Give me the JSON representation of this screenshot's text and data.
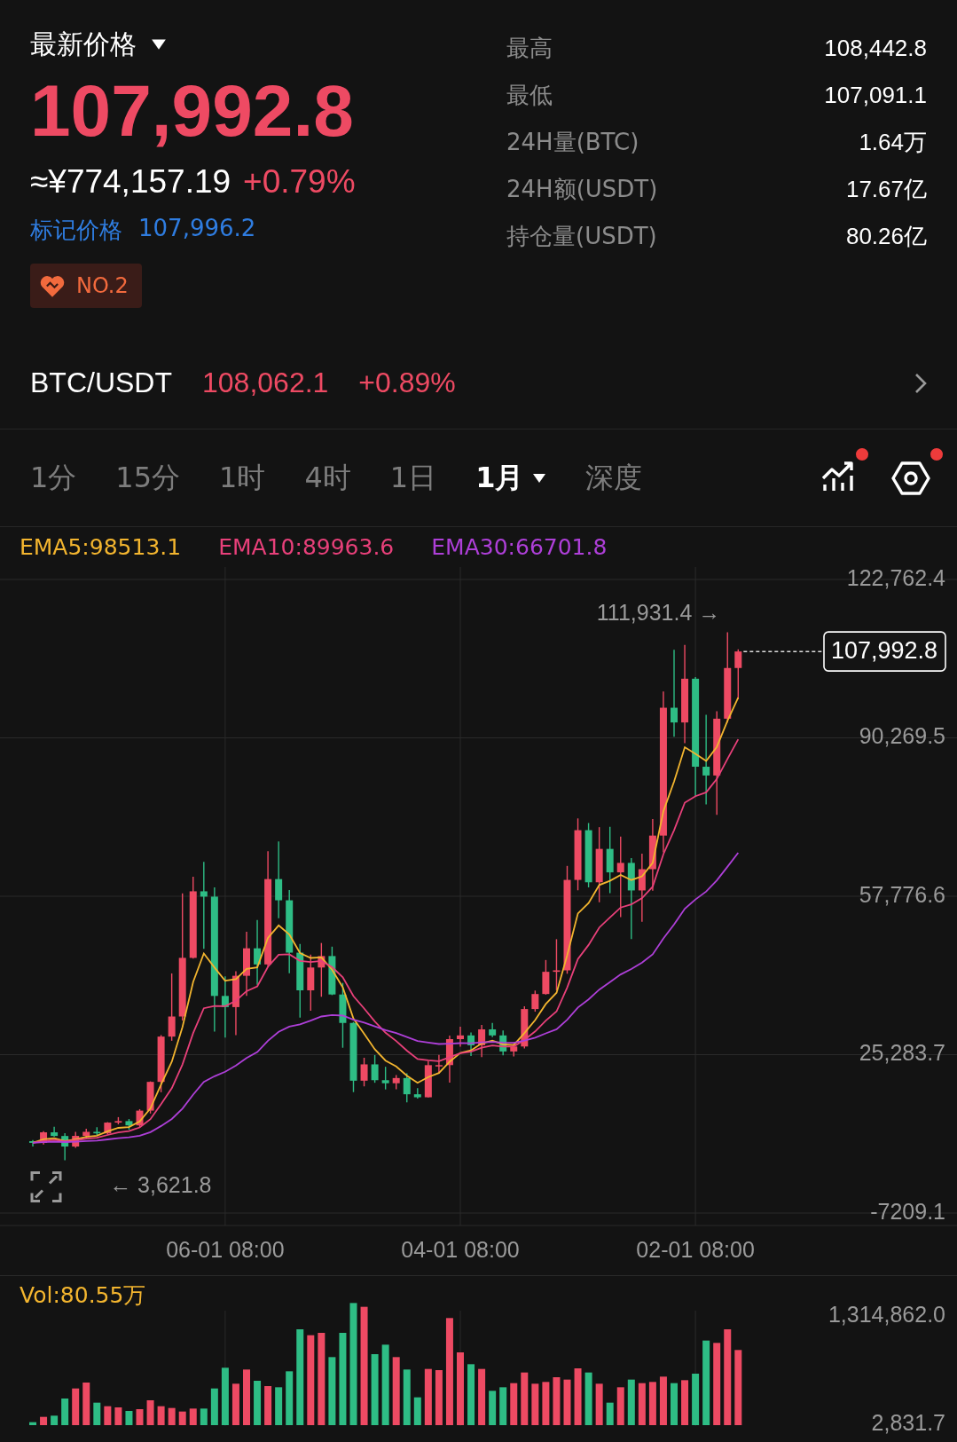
{
  "header": {
    "title": "最新价格",
    "price": "107,992.8",
    "cny": "≈¥774,157.19",
    "change": "+0.79%",
    "mark_label": "标记价格",
    "mark_price": "107,996.2",
    "rank": "NO.2"
  },
  "stats": [
    {
      "label": "最高",
      "value": "108,442.8"
    },
    {
      "label": "最低",
      "value": "107,091.1"
    },
    {
      "label": "24H量(BTC)",
      "value": "1.64万"
    },
    {
      "label": "24H额(USDT)",
      "value": "17.67亿"
    },
    {
      "label": "持仓量(USDT)",
      "value": "80.26亿"
    }
  ],
  "spot": {
    "pair": "BTC/USDT",
    "price": "108,062.1",
    "change": "+0.89%"
  },
  "tabs": [
    {
      "label": "1分",
      "selected": false,
      "menu": false
    },
    {
      "label": "15分",
      "selected": false,
      "menu": false
    },
    {
      "label": "1时",
      "selected": false,
      "menu": false
    },
    {
      "label": "4时",
      "selected": false,
      "menu": false
    },
    {
      "label": "1日",
      "selected": false,
      "menu": false
    },
    {
      "label": "1月",
      "selected": true,
      "menu": true
    },
    {
      "label": "深度",
      "selected": false,
      "menu": false
    }
  ],
  "toolbar": [
    {
      "kind": "indicators",
      "badge": true
    },
    {
      "kind": "settings",
      "badge": true
    }
  ],
  "chart": {
    "chart_data": {
      "type": "candlestick",
      "grid": true,
      "categories": [
        null,
        null,
        null,
        null,
        null,
        null,
        null,
        null,
        null,
        null,
        null,
        null,
        null,
        null,
        null,
        null,
        null,
        null,
        "06-01 08:00",
        null,
        null,
        null,
        null,
        null,
        null,
        null,
        null,
        null,
        null,
        null,
        null,
        null,
        null,
        null,
        null,
        null,
        null,
        null,
        null,
        null,
        "04-01 08:00",
        null,
        null,
        null,
        null,
        null,
        null,
        null,
        null,
        null,
        null,
        null,
        null,
        null,
        null,
        null,
        null,
        null,
        null,
        null,
        null,
        null,
        "02-01 08:00",
        null,
        null,
        null,
        null
      ],
      "series": [
        {
          "name": "EMA5:98513.1",
          "type": "line",
          "color": "#f3b52f",
          "values": [
            7190,
            7910,
            8140,
            7573,
            7922,
            8431,
            8668,
            9562,
            10258,
            10432,
            11553,
            14270,
            19176,
            23821,
            30927,
            40215,
            46043,
            43139,
            40439,
            40779,
            42886,
            43188,
            49225,
            51800,
            49937,
            46118,
            45132,
            45258,
            42715,
            39074,
            32696,
            29560,
            26390,
            24067,
            22875,
            20970,
            19493,
            20705,
            21517,
            23835,
            25633,
            26159,
            27596,
            28141,
            27407,
            27258,
            29719,
            32386,
            35684,
            37983,
            45698,
            54242,
            56375,
            60080,
            60947,
            62171,
            61104,
            61846,
            64637,
            75242,
            81304,
            88336,
            87008,
            85522,
            88414,
            93810,
            98537
          ]
        },
        {
          "name": "EMA10:89963.6",
          "type": "line",
          "color": "#e8407a",
          "values": [
            7190,
            7583,
            7768,
            7526,
            7725,
            8039,
            8239,
            8805,
            9322,
            9587,
            10353,
            12052,
            15132,
            18401,
            23262,
            29722,
            34809,
            35267,
            35226,
            36359,
            38312,
            39308,
            43307,
            45787,
            45864,
            44522,
            44274,
            44499,
            43250,
            41166,
            37307,
            34758,
            32084,
            29782,
            28092,
            26105,
            24366,
            24141,
            23959,
            24779,
            25588,
            25883,
            26717,
            27174,
            26950,
            26952,
            28349,
            30053,
            32276,
            34150,
            39055,
            44923,
            47781,
            51364,
            53422,
            55458,
            56096,
            57412,
            59740,
            66415,
            71327,
            76976,
            78317,
            79087,
            81835,
            85974,
            89977
          ]
        },
        {
          "name": "EMA30:66701.8",
          "type": "line",
          "color": "#ae3fd8",
          "values": [
            7190,
            7329,
            7411,
            7349,
            7431,
            7561,
            7663,
            7901,
            8143,
            8313,
            8667,
            9379,
            10644,
            12093,
            14225,
            17100,
            19720,
            20856,
            21771,
            23041,
            24593,
            25832,
            28120,
            29980,
            31027,
            31508,
            32260,
            33115,
            33406,
            33302,
            32440,
            31849,
            31088,
            30335,
            29700,
            28891,
            28094,
            27774,
            27475,
            27539,
            27648,
            27620,
            27804,
            27896,
            27770,
            27717,
            28164,
            28781,
            29652,
            30486,
            32463,
            34970,
            36626,
            38618,
            40170,
            41747,
            42859,
            44179,
            45859,
            49123,
            51982,
            55235,
            57113,
            58754,
            61041,
            63851,
            66699
          ]
        }
      ],
      "ylim": [
        -7209.1,
        122762.4
      ],
      "yticks": [
        {
          "value": 122762.4,
          "label": "122,762.4"
        },
        {
          "value": 90269.5,
          "label": "90,269.5"
        },
        {
          "value": 57776.6,
          "label": "57,776.6"
        },
        {
          "value": 25283.7,
          "label": "25,283.7"
        },
        {
          "value": -7209.1,
          "label": "-7209.1"
        }
      ],
      "annotations": [
        "111,931.4 →",
        "← 3,621.8",
        "107,992.8"
      ],
      "ohlc": [
        [
          7540,
          7750,
          6430,
          7190
        ],
        [
          7190,
          9580,
          6850,
          9350
        ],
        [
          9350,
          10500,
          8450,
          8600
        ],
        [
          8600,
          9190,
          3621.8,
          6440
        ],
        [
          6440,
          9460,
          6150,
          8620
        ],
        [
          8620,
          10070,
          8120,
          9450
        ],
        [
          9450,
          10380,
          8830,
          9140
        ],
        [
          9140,
          11440,
          8900,
          11350
        ],
        [
          11350,
          12470,
          10980,
          11650
        ],
        [
          11650,
          12080,
          9880,
          10780
        ],
        [
          10780,
          14100,
          10420,
          13800
        ],
        [
          13800,
          19800,
          13210,
          19700
        ],
        [
          19700,
          29300,
          17570,
          28990
        ],
        [
          28990,
          41950,
          28130,
          33110
        ],
        [
          33110,
          58350,
          32300,
          45140
        ],
        [
          45140,
          61780,
          45000,
          58790
        ],
        [
          58790,
          64850,
          47000,
          57700
        ],
        [
          57700,
          59600,
          30000,
          37330
        ],
        [
          37330,
          41330,
          28800,
          35040
        ],
        [
          35040,
          42400,
          29280,
          41460
        ],
        [
          41460,
          50500,
          37330,
          47100
        ],
        [
          47100,
          52920,
          39600,
          43790
        ],
        [
          43790,
          67000,
          43280,
          61300
        ],
        [
          61300,
          69000,
          53250,
          56950
        ],
        [
          56950,
          59050,
          42000,
          46210
        ],
        [
          46210,
          47990,
          32900,
          38480
        ],
        [
          38480,
          45800,
          34300,
          43160
        ],
        [
          43160,
          48190,
          37160,
          45510
        ],
        [
          45510,
          47440,
          37500,
          37630
        ],
        [
          37630,
          40000,
          26700,
          31790
        ],
        [
          31790,
          31990,
          17600,
          19940
        ],
        [
          19940,
          24650,
          18780,
          23290
        ],
        [
          23290,
          25200,
          19520,
          20050
        ],
        [
          20050,
          22800,
          18150,
          19420
        ],
        [
          19420,
          21090,
          18190,
          20490
        ],
        [
          20490,
          21450,
          15480,
          17160
        ],
        [
          17160,
          18390,
          16260,
          16540
        ],
        [
          16540,
          23950,
          16500,
          23130
        ],
        [
          23130,
          25250,
          21350,
          23140
        ],
        [
          23140,
          29190,
          19570,
          28470
        ],
        [
          28470,
          31000,
          26940,
          29230
        ],
        [
          29230,
          29820,
          25000,
          27210
        ],
        [
          27210,
          31390,
          24800,
          30470
        ],
        [
          30470,
          31800,
          28860,
          29230
        ],
        [
          29230,
          30230,
          25160,
          25940
        ],
        [
          25940,
          27490,
          24900,
          26960
        ],
        [
          26960,
          35200,
          26560,
          34640
        ],
        [
          34640,
          38430,
          34100,
          37720
        ],
        [
          37720,
          44700,
          37600,
          42280
        ],
        [
          42280,
          48970,
          38500,
          42580
        ],
        [
          42580,
          64000,
          41880,
          61130
        ],
        [
          61130,
          73750,
          59000,
          71330
        ],
        [
          71330,
          72800,
          59600,
          60640
        ],
        [
          60640,
          71950,
          56550,
          67490
        ],
        [
          67490,
          72000,
          58400,
          62680
        ],
        [
          62680,
          70000,
          53500,
          64620
        ],
        [
          64620,
          65600,
          49000,
          58970
        ],
        [
          58970,
          66500,
          52550,
          63330
        ],
        [
          63330,
          73600,
          58900,
          70220
        ],
        [
          70220,
          99800,
          66800,
          96450
        ],
        [
          96450,
          108350,
          90500,
          93430
        ],
        [
          93430,
          109350,
          89200,
          102400
        ],
        [
          102400,
          102750,
          78200,
          84350
        ],
        [
          84350,
          95000,
          76600,
          82550
        ],
        [
          82550,
          95750,
          74500,
          94200
        ],
        [
          94200,
          111931.4,
          93400,
          104600
        ],
        [
          104600,
          108442.8,
          98200,
          107992.8
        ]
      ]
    }
  },
  "volume": {
    "legend": "Vol:80.55万",
    "chart_data": {
      "type": "bar",
      "grid": true,
      "categories": [
        null,
        null,
        null,
        null,
        null,
        null,
        null,
        null,
        null,
        null,
        null,
        null,
        null,
        null,
        null,
        null,
        null,
        null,
        null,
        null,
        null,
        null,
        null,
        null,
        null,
        null,
        null,
        null,
        null,
        null,
        null,
        null,
        null,
        null,
        null,
        null,
        null,
        null,
        null,
        null,
        null,
        null,
        null,
        null,
        null,
        null,
        null,
        null,
        null,
        null,
        null,
        null,
        null,
        null,
        null,
        null,
        null,
        null,
        null,
        null,
        null,
        null,
        null,
        null,
        null,
        null,
        null
      ],
      "ylim": [
        0,
        1817500
      ],
      "yticks": [
        {
          "value": 1314862.0,
          "label": "1,314,862.0"
        },
        {
          "value": 2831.7,
          "label": "2,831.7"
        }
      ],
      "values": [
        35850,
        100380,
        114720,
        322650,
        444540,
        516240,
        272460,
        229440,
        215100,
        172080,
        193590,
        301140,
        229440,
        207930,
        164910,
        200760,
        200760,
        444540,
        695490,
        501900,
        673980,
        537750,
        473220,
        458880,
        652470,
        1161540,
        1089840,
        1118520,
        824550,
        1118520,
        1480000,
        1434000,
        860400,
        975120,
        824550,
        673980,
        336990,
        681150,
        666810,
        1297770,
        881910,
        738510,
        681150,
        415860,
        458880,
        509070,
        638130,
        501900,
        523410,
        580770,
        552090,
        688320,
        638130,
        501900,
        272460,
        458880,
        552090,
        509070,
        523410,
        587940,
        509070,
        544920,
        623790,
        1025310,
        996630,
        1161540,
        910590
      ]
    }
  }
}
